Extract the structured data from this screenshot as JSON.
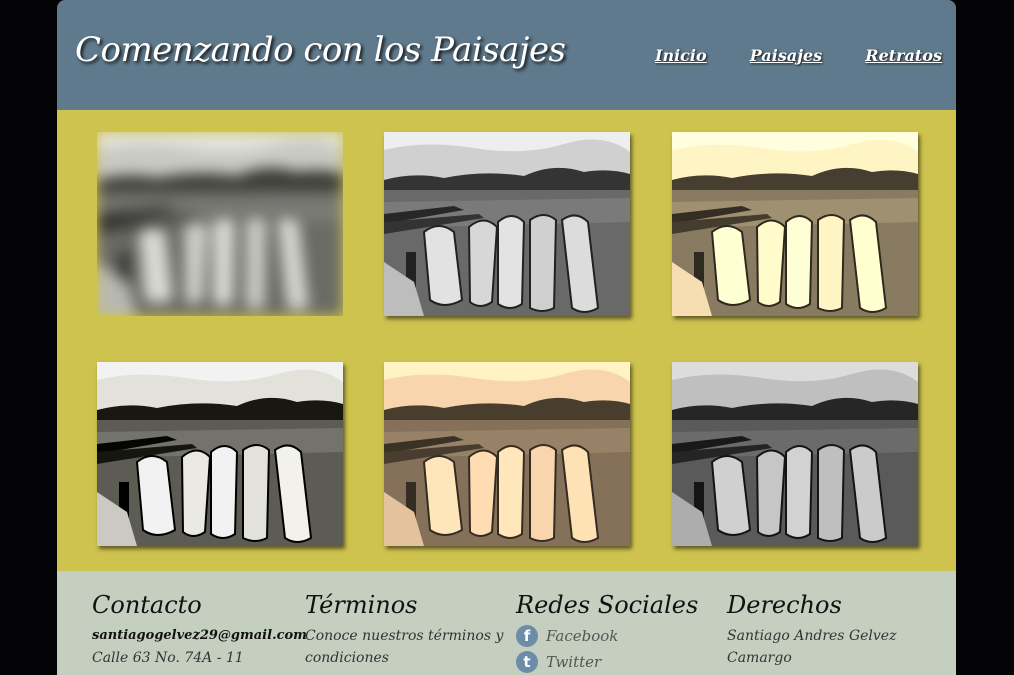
{
  "header": {
    "title": "Comenzando con los Paisajes",
    "nav": [
      {
        "label": "Inicio"
      },
      {
        "label": "Paisajes"
      },
      {
        "label": "Retratos"
      }
    ]
  },
  "gallery": {
    "photos": [
      {
        "filter": "blurred"
      },
      {
        "filter": "grayscale"
      },
      {
        "filter": "sepia"
      },
      {
        "filter": "high-contrast"
      },
      {
        "filter": "saturated"
      },
      {
        "filter": "grayscale-dark"
      }
    ]
  },
  "footer": {
    "contact": {
      "title": "Contacto",
      "email": "santiagogelvez29@gmail.com",
      "address": "Calle 63 No. 74A - 11"
    },
    "terms": {
      "title": "Términos",
      "text": "Conoce nuestros términos y condiciones"
    },
    "social": {
      "title": "Redes Sociales",
      "items": [
        {
          "label": "Facebook",
          "icon": "facebook-icon"
        },
        {
          "label": "Twitter",
          "icon": "twitter-icon"
        }
      ]
    },
    "rights": {
      "title": "Derechos",
      "text": "Santiago Andres Gelvez Camargo"
    }
  },
  "colors": {
    "header_bg": "#5f7a8c",
    "main_bg": "#cfc34f",
    "footer_bg": "#c4cfc0",
    "page_bg": "#030306"
  }
}
